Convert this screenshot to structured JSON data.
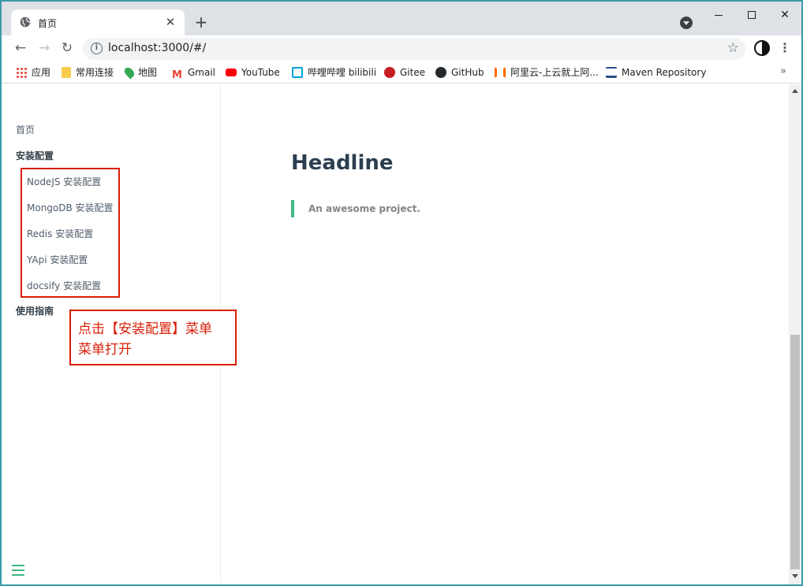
{
  "browser": {
    "tab_title": "首页",
    "tab_close": "✕",
    "new_tab": "+",
    "url": "localhost:3000/#/",
    "bookmarks": [
      {
        "label": "应用",
        "icon": "apps-grid-icon",
        "color": "#ea4335"
      },
      {
        "label": "常用连接",
        "icon": "folder-icon",
        "color": "#f9cc4c"
      },
      {
        "label": "地图",
        "icon": "maps-pin-icon",
        "color": "#34a853"
      },
      {
        "label": "Gmail",
        "icon": "gmail-icon",
        "color": "#ea4335"
      },
      {
        "label": "YouTube",
        "icon": "youtube-icon",
        "color": "#ff0000"
      },
      {
        "label": "哔哩哔哩 bilibili",
        "icon": "bilibili-icon",
        "color": "#00a1d6"
      },
      {
        "label": "Gitee",
        "icon": "gitee-icon",
        "color": "#c71d23"
      },
      {
        "label": "GitHub",
        "icon": "github-icon",
        "color": "#24292e"
      },
      {
        "label": "阿里云-上云就上阿...",
        "icon": "aliyun-icon",
        "color": "#ff6a00"
      },
      {
        "label": "Maven Repository",
        "icon": "maven-icon",
        "color": "#2b4c8c"
      }
    ],
    "bookmarks_more": "»"
  },
  "sidebar": {
    "home": "首页",
    "group_install": "安装配置",
    "install_items": [
      "NodeJS 安装配置",
      "MongoDB 安装配置",
      "Redis 安装配置",
      "YApi 安装配置",
      "docsify 安装配置"
    ],
    "group_guide": "使用指南"
  },
  "callout": {
    "line1": "点击【安装配置】菜单",
    "line2": "菜单打开"
  },
  "main": {
    "headline": "Headline",
    "quote": "An awesome project."
  },
  "colors": {
    "accent": "#42b983",
    "annotation": "#d81e06",
    "heading": "#2c3e50"
  }
}
